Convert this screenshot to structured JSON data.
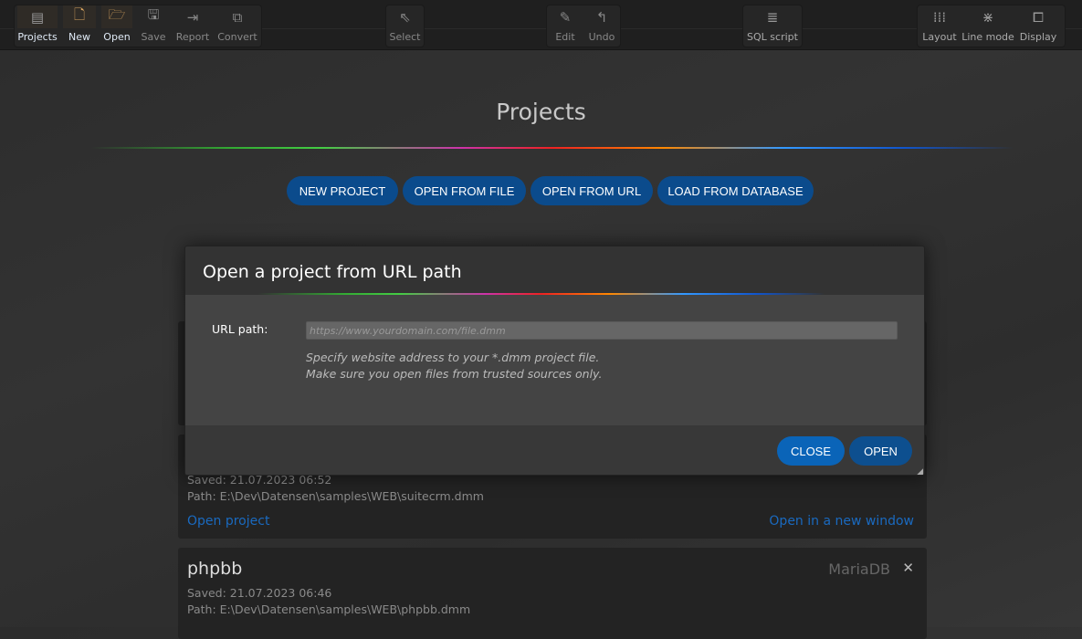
{
  "toolbar": {
    "group1": [
      {
        "label": "Projects",
        "icon": "projects-icon"
      },
      {
        "label": "New",
        "icon": "new-file-icon"
      },
      {
        "label": "Open",
        "icon": "folder-open-icon"
      },
      {
        "label": "Save",
        "icon": "save-icon"
      },
      {
        "label": "Report",
        "icon": "report-icon"
      },
      {
        "label": "Convert",
        "icon": "convert-icon"
      }
    ],
    "select": {
      "label": "Select",
      "icon": "cursor-icon"
    },
    "edit": {
      "label": "Edit",
      "icon": "pencil-icon"
    },
    "undo": {
      "label": "Undo",
      "icon": "undo-icon"
    },
    "sql": {
      "label": "SQL script",
      "icon": "script-icon"
    },
    "layout": {
      "label": "Layout",
      "icon": "grid-icon"
    },
    "linemode": {
      "label": "Line mode",
      "icon": "line-mode-icon"
    },
    "display": {
      "label": "Display",
      "icon": "display-icon"
    }
  },
  "page": {
    "title": "Projects",
    "actions": [
      "NEW PROJECT",
      "OPEN FROM FILE",
      "OPEN FROM URL",
      "LOAD FROM DATABASE"
    ]
  },
  "projects": [
    {
      "saved": "Saved: 21.07.2023 06:52",
      "path": "Path: E:\\Dev\\Datensen\\samples\\WEB\\suitecrm.dmm",
      "open": "Open project",
      "open_new": "Open in a new window"
    },
    {
      "name": "phpbb",
      "db": "MariaDB",
      "saved": "Saved: 21.07.2023 06:46",
      "path": "Path: E:\\Dev\\Datensen\\samples\\WEB\\phpbb.dmm"
    }
  ],
  "dialog": {
    "title": "Open a project from URL path",
    "url_label": "URL path:",
    "url_placeholder": "https://www.yourdomain.com/file.dmm",
    "url_value": "",
    "hint1": "Specify website address to your *.dmm project file.",
    "hint2": "Make sure you open files from trusted sources only.",
    "close": "CLOSE",
    "open": "OPEN"
  },
  "colors": {
    "accent": "#0b4b8c",
    "close_btn": "#0a64b8",
    "open_btn": "#0d4f8f"
  }
}
